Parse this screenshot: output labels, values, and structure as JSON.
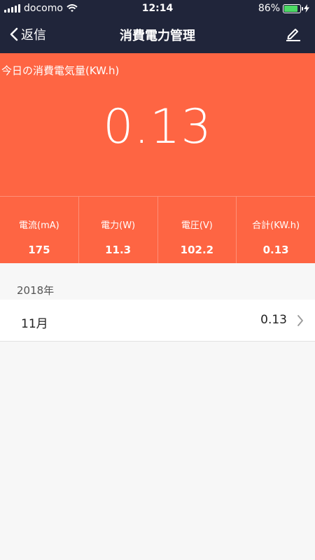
{
  "status_bar": {
    "carrier": "docomo",
    "time": "12:14",
    "battery": "86%",
    "battery_level": 0.86,
    "battery_color": "#4cd964"
  },
  "nav": {
    "back_label": "返信",
    "title": "消費電力管理",
    "edit_icon": "pencil-icon"
  },
  "summary": {
    "label": "今日の消費電気量(KW.h)",
    "value": "0.13",
    "accent_color": "#fe6543"
  },
  "stats": [
    {
      "label": "電流(mA)",
      "value": "175"
    },
    {
      "label": "電力(W)",
      "value": "11.3"
    },
    {
      "label": "電圧(V)",
      "value": "102.2"
    },
    {
      "label": "合計(KW.h)",
      "value": "0.13"
    }
  ],
  "history": {
    "year": "2018年",
    "months": [
      {
        "label": "11月",
        "value": "0.13"
      }
    ]
  }
}
